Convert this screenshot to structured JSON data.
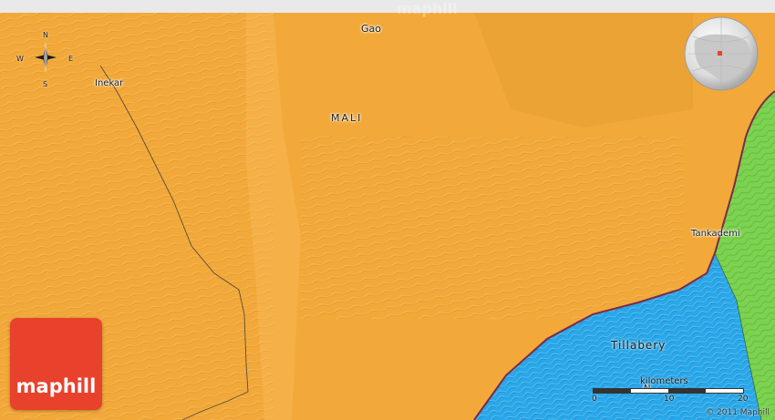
{
  "watermark": "maphill",
  "places": {
    "gao": "Gao",
    "mali": "MALI",
    "inekar": "Inekar",
    "tankademi": "Tankademi",
    "tillabery": "Tillabery",
    "niger_partial": "N"
  },
  "compass": {
    "n": "N",
    "s": "S",
    "e": "E",
    "w": "W"
  },
  "scale": {
    "unit": "kilometers",
    "ticks": [
      "0",
      "10",
      "20"
    ]
  },
  "brand": {
    "label": "maphill"
  },
  "copyright": "© 2011 Maphill",
  "colors": {
    "mali_land": "#f2a93a",
    "niger_land": "#7cd34f",
    "water_region": "#27a8ea",
    "border": "#7a2a4a",
    "brand": "#e8412c"
  }
}
